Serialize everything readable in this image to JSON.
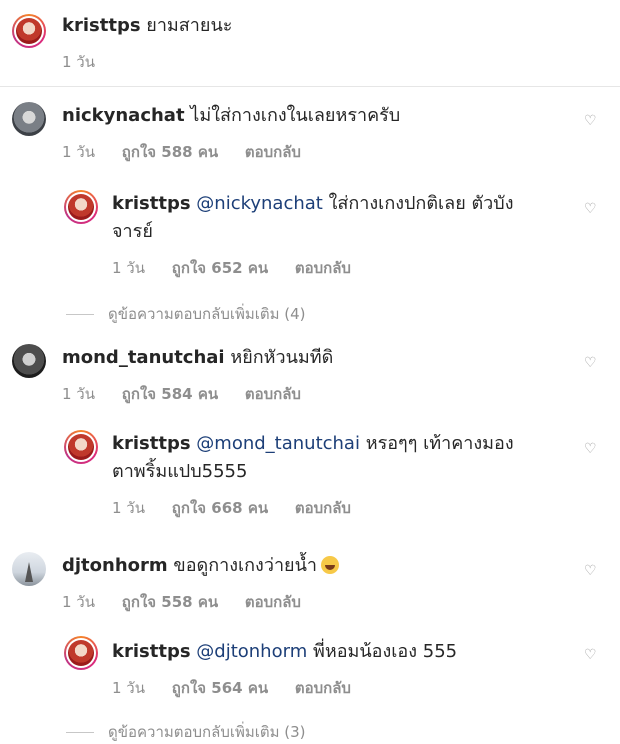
{
  "caption": {
    "username": "kristtps",
    "text": "ยามสายนะ",
    "time": "1 วัน"
  },
  "comments": [
    {
      "username": "nickynachat",
      "text": "ไม่ใส่กางเกงในเลยหราครับ",
      "time": "1 วัน",
      "likes": "ถูกใจ 588 คน",
      "reply": "ตอบกลับ"
    },
    {
      "username": "kristtps",
      "mention": "@nickynachat",
      "text": "ใส่กางเกงปกติเลย ตัวบัง",
      "text2": "จารย์",
      "time": "1 วัน",
      "likes": "ถูกใจ 652 คน",
      "reply": "ตอบกลับ"
    },
    {
      "more": "ดูข้อความตอบกลับเพิ่มเติม (4)"
    },
    {
      "username": "mond_tanutchai",
      "text": "หยิกหัวนมทีดิ",
      "time": "1 วัน",
      "likes": "ถูกใจ 584 คน",
      "reply": "ตอบกลับ"
    },
    {
      "username": "kristtps",
      "mention": "@mond_tanutchai",
      "text": "หรอๆๆ เท้าคางมอง",
      "text2": "ตาพริ้มแปบ5555",
      "time": "1 วัน",
      "likes": "ถูกใจ 668 คน",
      "reply": "ตอบกลับ"
    },
    {
      "username": "djtonhorm",
      "text": "ขอดูกางเกงว่ายน้ำ",
      "emoji": "grinning-face-with-sweat",
      "time": "1 วัน",
      "likes": "ถูกใจ 558 คน",
      "reply": "ตอบกลับ"
    },
    {
      "username": "kristtps",
      "mention": "@djtonhorm",
      "text": "พี่หอมน้องเอง 555",
      "time": "1 วัน",
      "likes": "ถูกใจ 564 คน",
      "reply": "ตอบกลับ"
    },
    {
      "more": "ดูข้อความตอบกลับเพิ่มเติม (3)"
    }
  ],
  "icons": {
    "like": "heart-outline-icon"
  }
}
